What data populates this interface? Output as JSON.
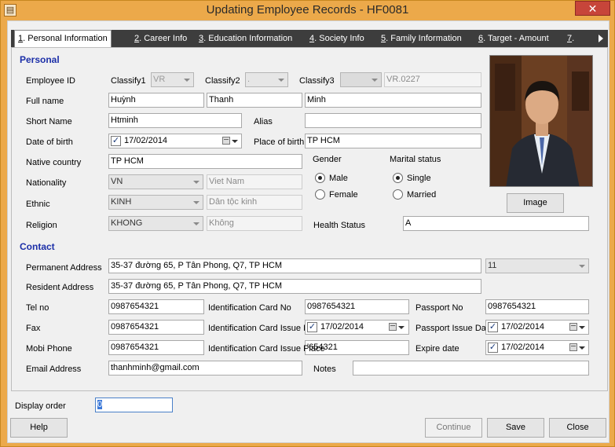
{
  "window": {
    "title": "Updating Employee Records - HF0081",
    "close_glyph": "✕",
    "icon_glyph": "▤"
  },
  "tabs": [
    {
      "num": "1",
      "label": ". Personal Information"
    },
    {
      "num": "2",
      "label": ". Career Info"
    },
    {
      "num": "3",
      "label": ". Education Information"
    },
    {
      "num": "4",
      "label": ". Society Info"
    },
    {
      "num": "5",
      "label": ". Family Information"
    },
    {
      "num": "6",
      "label": ". Target - Amount"
    },
    {
      "num": "7",
      "label": "."
    }
  ],
  "personal": {
    "section_label": "Personal",
    "employee_id_label": "Employee ID",
    "classify1_label": "Classify1",
    "classify1_value": "VR",
    "classify2_label": "Classify2",
    "classify2_value": ".",
    "classify3_label": "Classify3",
    "classify3_value": "",
    "employee_id_value": "VR.0227",
    "full_name_label": "Full name",
    "last_name": "Huỳnh",
    "middle_name": "Thanh",
    "first_name": "Minh",
    "short_name_label": "Short Name",
    "short_name": "Htminh",
    "alias_label": "Alias",
    "alias": "",
    "dob_label": "Date of birth",
    "dob": "17/02/2014",
    "pob_label": "Place of birth",
    "pob": "TP HCM",
    "native_country_label": "Native country",
    "native_country": "TP HCM",
    "gender_label": "Gender",
    "male_label": "Male",
    "female_label": "Female",
    "marital_label": "Marital status",
    "single_label": "Single",
    "married_label": "Married",
    "nationality_label": "Nationality",
    "nationality_code": "VN",
    "nationality_name": "Viet Nam",
    "ethnic_label": "Ethnic",
    "ethnic_code": "KINH",
    "ethnic_name": "Dân tộc kinh",
    "religion_label": "Religion",
    "religion_code": "KHONG",
    "religion_name": "Không",
    "health_label": "Health Status",
    "health": "A",
    "image_button": "Image"
  },
  "contact": {
    "section_label": "Contact",
    "perm_label": "Permanent Address",
    "perm_address": "35-37 đường 65, P Tân Phong, Q7, TP HCM",
    "perm_extra": "11",
    "res_label": "Resident Address",
    "res_address": "35-37 đường 65, P Tân Phong, Q7, TP HCM",
    "tel_label": "Tel no",
    "tel": "0987654321",
    "idcard_label": "Identification Card No",
    "idcard": "0987654321",
    "passport_label": "Passport No",
    "passport": "0987654321",
    "fax_label": "Fax",
    "fax": "0987654321",
    "id_issue_date_label": "Identification Card Issue D",
    "id_issue_date": "17/02/2014",
    "pp_issue_label": "Passport Issue Da",
    "pp_issue_date": "17/02/2014",
    "mobi_label": "Mobi Phone",
    "mobi": "0987654321",
    "id_issue_place_label": "Identification Card Issue Place",
    "id_issue_place": "'654321",
    "expire_label": "Expire date",
    "expire_date": "17/02/2014",
    "email_label": "Email Address",
    "email": "thanhminh@gmail.com",
    "notes_label": "Notes",
    "notes": ""
  },
  "footer": {
    "display_order_label": "Display order",
    "display_order": "0",
    "help": "Help",
    "continue": "Continue",
    "save": "Save",
    "close": "Close"
  }
}
